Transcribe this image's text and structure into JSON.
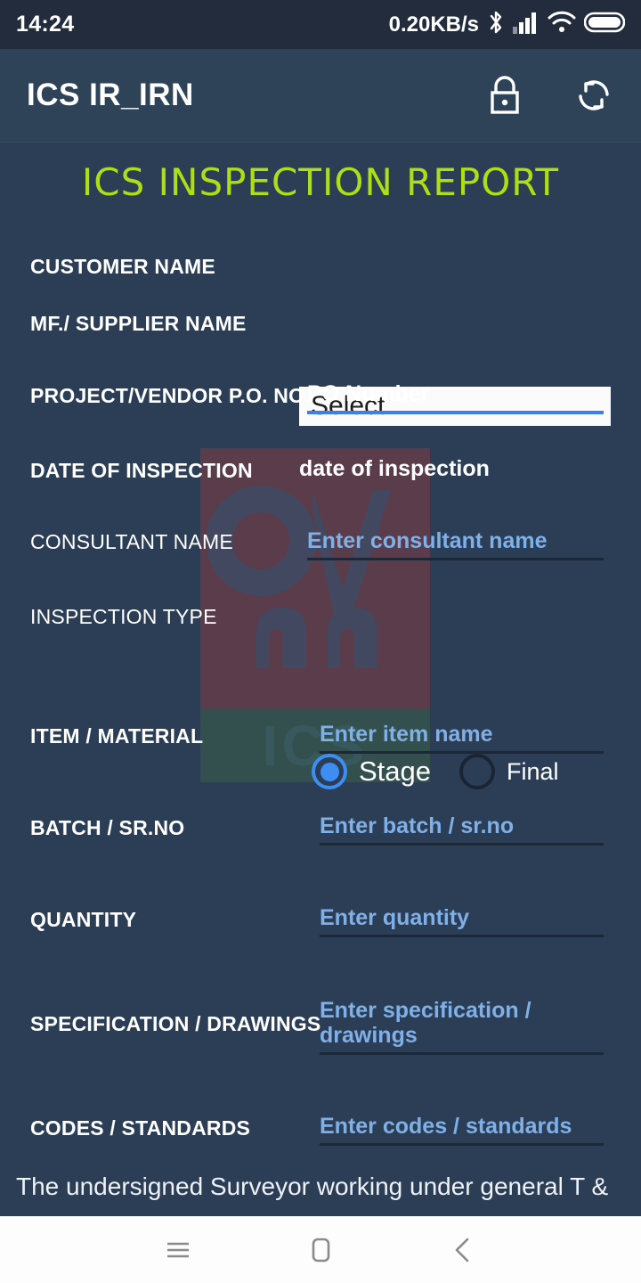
{
  "statusbar": {
    "clock": "14:24",
    "network_speed": "0.20KB/s",
    "icons": [
      "bluetooth-icon",
      "cellular-signal-icon",
      "wifi-icon",
      "battery-icon"
    ]
  },
  "appbar": {
    "title": "ICS IR_IRN",
    "lock_label": "lock-icon",
    "sync_label": "sync-icon"
  },
  "form": {
    "title": "ICS INSPECTION REPORT",
    "title_color": "#aede15",
    "accent_color": "#3d8ef0",
    "background_color": "#2b3e56",
    "fields": {
      "customer_name": {
        "label": "CUSTOMER NAME",
        "value": "Select"
      },
      "supplier_name": {
        "label": "MF./ SUPPLIER NAME"
      },
      "po_no": {
        "label": "PROJECT/VENDOR P.O. NO.",
        "value": "PO Number"
      },
      "date_of_inspection": {
        "label": "DATE OF INSPECTION",
        "value": "date of inspection"
      },
      "consultant_name": {
        "label": "CONSULTANT NAME",
        "placeholder": "Enter consultant name"
      },
      "inspection_type": {
        "label": "INSPECTION TYPE",
        "options": [
          "Stage",
          "Final"
        ],
        "selected": "Stage"
      },
      "item_material": {
        "label": "ITEM / MATERIAL",
        "placeholder": "Enter item name"
      },
      "batch_srno": {
        "label": "BATCH / SR.NO",
        "placeholder": "Enter batch / sr.no"
      },
      "quantity": {
        "label": "QUANTITY",
        "placeholder": "Enter quantity"
      },
      "specification": {
        "label": "SPECIFICATION / DRAWINGS",
        "placeholder": "Enter specification / drawings"
      },
      "codes_standards": {
        "label": "CODES / STANDARDS",
        "placeholder": "Enter codes / standards"
      }
    },
    "footnote": "The undersigned Surveyor working under general T &"
  },
  "watermark": {
    "text": "ICS"
  },
  "navbar": {
    "recents_label": "recents-icon",
    "home_label": "home-icon",
    "back_label": "back-icon"
  }
}
